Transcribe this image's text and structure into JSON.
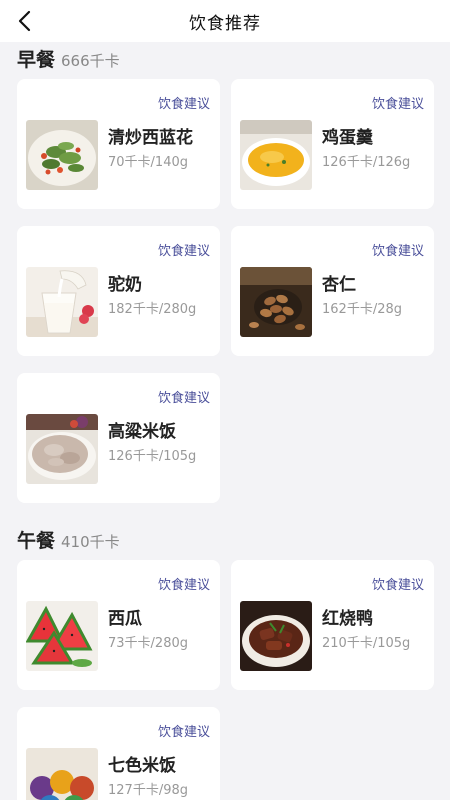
{
  "header": {
    "title": "饮食推荐",
    "back_icon": "chevron-left-icon"
  },
  "sections": [
    {
      "name": "早餐",
      "calories": "666千卡",
      "items": [
        {
          "name": "清炒西蓝花",
          "info": "70千卡/140g",
          "advice": "饮食建议"
        },
        {
          "name": "鸡蛋羹",
          "info": "126千卡/126g",
          "advice": "饮食建议"
        },
        {
          "name": "驼奶",
          "info": "182千卡/280g",
          "advice": "饮食建议"
        },
        {
          "name": "杏仁",
          "info": "162千卡/28g",
          "advice": "饮食建议"
        },
        {
          "name": "高粱米饭",
          "info": "126千卡/105g",
          "advice": "饮食建议"
        }
      ]
    },
    {
      "name": "午餐",
      "calories": "410千卡",
      "items": [
        {
          "name": "西瓜",
          "info": "73千卡/280g",
          "advice": "饮食建议"
        },
        {
          "name": "红烧鸭",
          "info": "210千卡/105g",
          "advice": "饮食建议"
        },
        {
          "name": "七色米饭",
          "info": "127千卡/98g",
          "advice": "饮食建议"
        }
      ]
    }
  ],
  "colors": {
    "accent": "#4a4f9a",
    "background": "#f3f3f6",
    "card": "#ffffff"
  }
}
